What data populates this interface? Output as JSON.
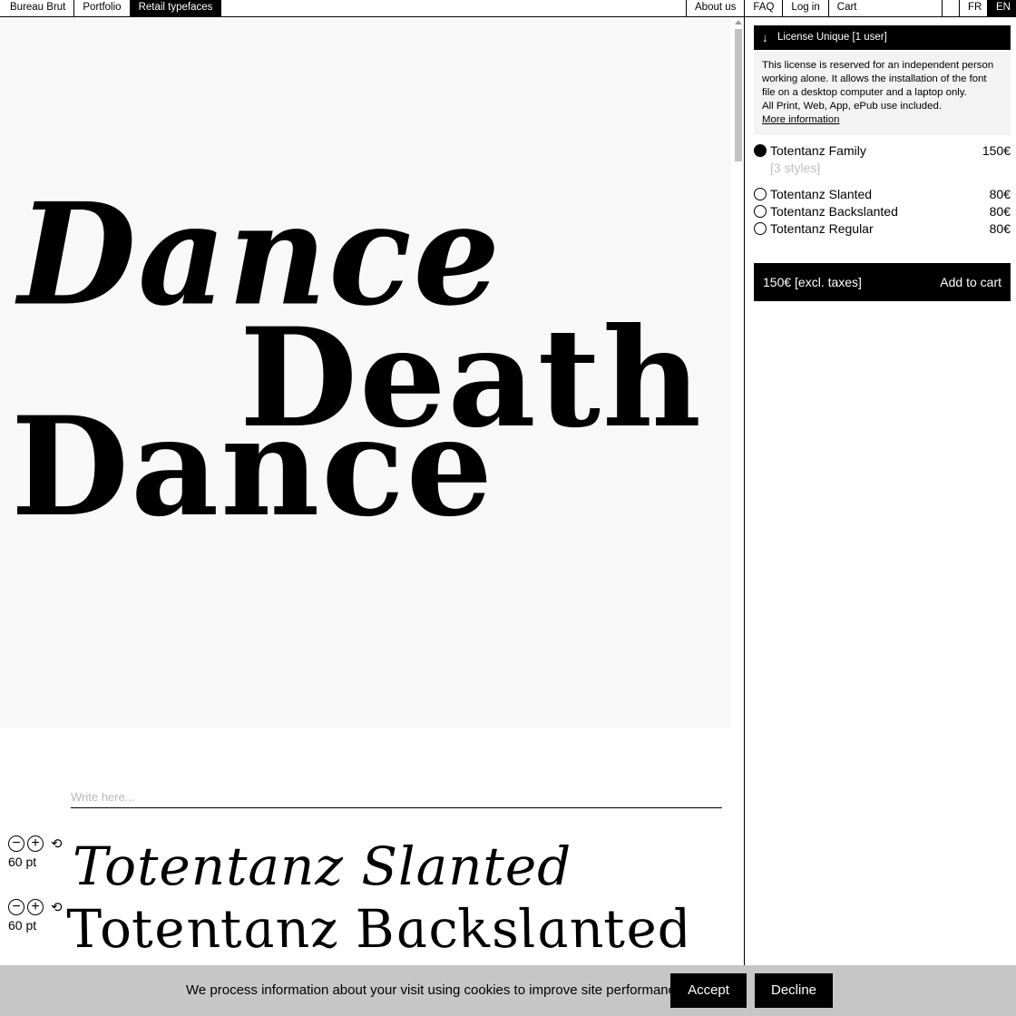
{
  "nav": {
    "left": [
      {
        "label": "Bureau Brut",
        "active": false
      },
      {
        "label": "Portfolio",
        "active": false
      },
      {
        "label": "Retail typefaces",
        "active": true
      }
    ],
    "right": [
      {
        "label": "About us"
      },
      {
        "label": "FAQ"
      },
      {
        "label": "Log in"
      },
      {
        "label": "Cart"
      }
    ],
    "languages": [
      {
        "label": "FR",
        "active": false
      },
      {
        "label": "EN",
        "active": true
      }
    ]
  },
  "hero": {
    "lines": [
      "Dance",
      "Death",
      "Dance"
    ]
  },
  "tester": {
    "placeholder": "Write here...",
    "samples": [
      {
        "name": "Totentanz Slanted",
        "size": "60 pt"
      },
      {
        "name": "Totentanz Backslanted",
        "size": "60 pt"
      }
    ],
    "icons": {
      "minus": "minus-icon",
      "plus": "plus-icon",
      "reset": "reset-icon"
    }
  },
  "license": {
    "title": "License Unique [1 user]",
    "description_lines": [
      "This license is reserved for an independent person",
      "working alone. It allows the installation of the font",
      "file on a desktop computer and a laptop only.",
      "All Print, Web, App, ePub  use included."
    ],
    "more_link": "More information"
  },
  "options": [
    {
      "name": "Totentanz Family",
      "sub": "[3 styles]",
      "price": "150€",
      "checked": true
    },
    {
      "name": "Totentanz Slanted",
      "price": "80€",
      "checked": false
    },
    {
      "name": "Totentanz Backslanted",
      "price": "80€",
      "checked": false
    },
    {
      "name": "Totentanz Regular",
      "price": "80€",
      "checked": false
    }
  ],
  "cart": {
    "total": "150€ [excl. taxes]",
    "add_label": "Add to cart"
  },
  "cookie": {
    "text": "We process information about your visit using cookies to improve site performance.",
    "accept": "Accept",
    "decline": "Decline"
  }
}
